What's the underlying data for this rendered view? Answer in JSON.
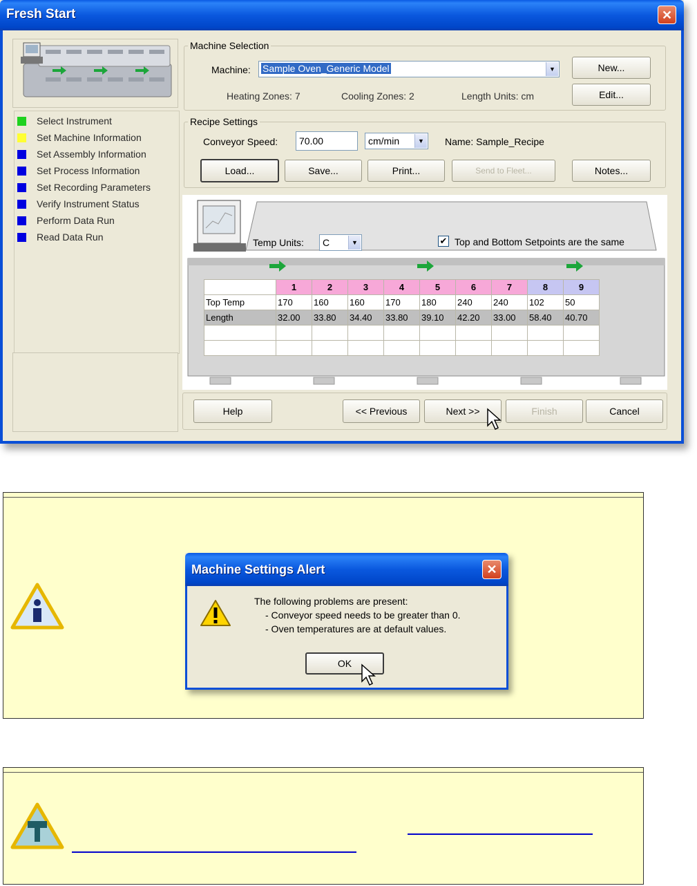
{
  "window": {
    "title": "Fresh Start",
    "close_label": "✕"
  },
  "steps": [
    {
      "label": "Select Instrument",
      "color": "#1fd21f"
    },
    {
      "label": "Set Machine Information",
      "color": "#ffff33"
    },
    {
      "label": "Set Assembly Information",
      "color": "#0000e0"
    },
    {
      "label": "Set Process Information",
      "color": "#0000e0"
    },
    {
      "label": "Set Recording Parameters",
      "color": "#0000e0"
    },
    {
      "label": "Verify Instrument Status",
      "color": "#0000e0"
    },
    {
      "label": "Perform Data Run",
      "color": "#0000e0"
    },
    {
      "label": "Read Data Run",
      "color": "#0000e0"
    }
  ],
  "machine_selection": {
    "legend": "Machine Selection",
    "machine_label": "Machine:",
    "machine_value": "Sample Oven_Generic Model",
    "heating_zones": "Heating Zones: 7",
    "cooling_zones": "Cooling Zones: 2",
    "length_units": "Length Units: cm",
    "new_label": "New...",
    "edit_label": "Edit..."
  },
  "recipe_settings": {
    "legend": "Recipe Settings",
    "speed_label": "Conveyor Speed:",
    "speed_value": "70.00",
    "speed_units": "cm/min",
    "name_text": "Name: Sample_Recipe",
    "load_label": "Load...",
    "save_label": "Save...",
    "print_label": "Print...",
    "saveto_label": "Send to Fleet...",
    "notes_label": "Notes..."
  },
  "oven_settings": {
    "temp_units_label": "Temp Units:",
    "temp_units_value": "C",
    "same_setpoints_label": "Top and Bottom Setpoints are the same",
    "same_setpoints_checked": true
  },
  "zones": {
    "headers": [
      "1",
      "2",
      "3",
      "4",
      "5",
      "6",
      "7",
      "8",
      "9"
    ],
    "rows": [
      {
        "label": "Top Temp",
        "values": [
          "170",
          "160",
          "160",
          "170",
          "180",
          "240",
          "240",
          "102",
          "50"
        ]
      },
      {
        "label": "Length",
        "values": [
          "32.00",
          "33.80",
          "34.40",
          "33.80",
          "39.10",
          "42.20",
          "33.00",
          "58.40",
          "40.70"
        ]
      },
      {
        "label": "",
        "values": [
          "",
          "",
          "",
          "",
          "",
          "",
          "",
          "",
          ""
        ]
      },
      {
        "label": "",
        "values": [
          "",
          "",
          "",
          "",
          "",
          "",
          "",
          "",
          ""
        ]
      }
    ]
  },
  "footer": {
    "help_label": "Help",
    "prev_label": "<< Previous",
    "next_label": "Next >>",
    "finish_label": "Finish",
    "cancel_label": "Cancel"
  },
  "alert": {
    "title": "Machine Settings Alert",
    "close_label": "✕",
    "line1": "The following problems are present:",
    "line2": "- Conveyor speed needs to be greater than 0.",
    "line3": "- Oven temperatures are at default values.",
    "ok_label": "OK"
  }
}
